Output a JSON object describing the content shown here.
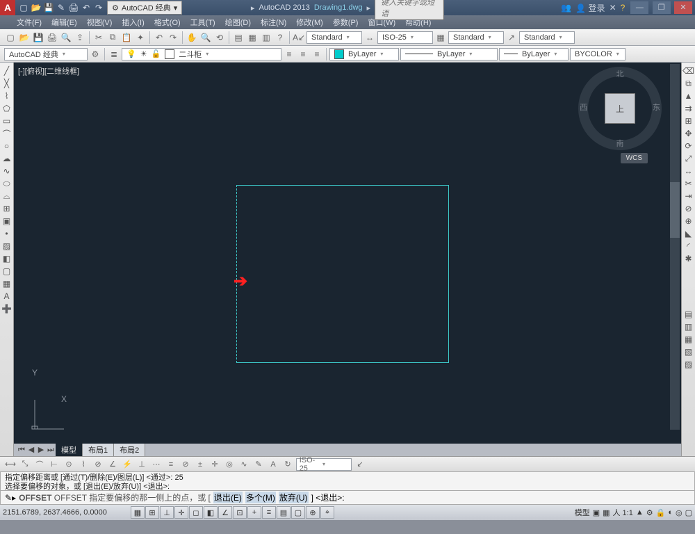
{
  "title": {
    "app": "AutoCAD 2013",
    "doc": "Drawing1.dwg",
    "search_ph": "键入关键字或短语",
    "workspace": "AutoCAD 经典",
    "login": "登录"
  },
  "menu": [
    "文件(F)",
    "编辑(E)",
    "视图(V)",
    "插入(I)",
    "格式(O)",
    "工具(T)",
    "绘图(D)",
    "标注(N)",
    "修改(M)",
    "参数(P)",
    "窗口(W)",
    "帮助(H)"
  ],
  "props": {
    "textstyle": "Standard",
    "dimstyle": "ISO-25",
    "tablestyle": "Standard",
    "mleader": "Standard",
    "workspace2": "AutoCAD 经典",
    "layer_combo": "二斗柜",
    "color": "ByLayer",
    "ltype": "ByLayer",
    "lweight": "ByLayer",
    "plot": "BYCOLOR"
  },
  "viewport": {
    "label": "[-][俯视][二维线框]"
  },
  "viewcube": {
    "n": "北",
    "s": "南",
    "e": "东",
    "w": "西",
    "top": "上",
    "wcs": "WCS"
  },
  "ucs": {
    "x": "X",
    "y": "Y"
  },
  "tabs": {
    "model": "模型",
    "layout1": "布局1",
    "layout2": "布局2"
  },
  "dim_dropdown": "ISO-25",
  "cmd": {
    "hist1": "指定偏移距离或 [通过(T)/删除(E)/图层(L)] <通过>:  25",
    "hist2": "选择要偏移的对象，或 [退出(E)/放弃(U)] <退出>:",
    "prefix": "OFFSET 指定要偏移的那一侧上的点，或 [",
    "opt1": "退出(E)",
    "opt2": "多个(M)",
    "opt3": "放弃(U)",
    "suffix": "] <退出>:"
  },
  "status": {
    "coords": "2151.6789, 2637.4666, 0.0000",
    "space": "模型",
    "scale": "人 1:1",
    "ann": "▲"
  }
}
